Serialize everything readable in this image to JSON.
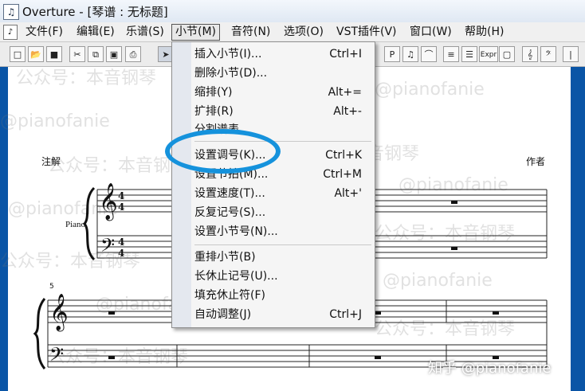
{
  "window": {
    "title": "Overture - [琴谱 : 无标题]"
  },
  "menubar": {
    "items": [
      "文件(F)",
      "编辑(E)",
      "乐谱(S)",
      "小节(M)",
      "音符(N)",
      "选项(O)",
      "VST插件(V)",
      "窗口(W)",
      "帮助(H)"
    ],
    "active": "小节(M)"
  },
  "toolbar": {
    "buttons": [
      "new",
      "open",
      "save",
      "cut",
      "copy",
      "paste",
      "print",
      "select-arrow",
      "p",
      "note",
      "slur",
      "beam",
      "staff",
      "expr",
      "box",
      "treble",
      "bass",
      "bar"
    ],
    "labels": {
      "p": "P",
      "expr": "Expr"
    }
  },
  "score": {
    "annotation_label": "注解",
    "composer_label": "作者",
    "instrument": "Piano",
    "measure_number": "5",
    "time_signature": "4/4"
  },
  "dropdown": {
    "items": [
      {
        "label": "插入小节(I)...",
        "shortcut": "Ctrl+I"
      },
      {
        "label": "删除小节(D)...",
        "shortcut": ""
      },
      {
        "label": "缩排(Y)",
        "shortcut": "Alt+="
      },
      {
        "label": "扩排(R)",
        "shortcut": "Alt+-"
      },
      {
        "label": "分割谱表",
        "shortcut": ""
      },
      {
        "label": "设置调号(K)...",
        "shortcut": "Ctrl+K"
      },
      {
        "label": "设置节拍(M)...",
        "shortcut": "Ctrl+M"
      },
      {
        "label": "设置速度(T)...",
        "shortcut": "Alt+'"
      },
      {
        "label": "反复记号(S)...",
        "shortcut": ""
      },
      {
        "label": "设置小节号(N)...",
        "shortcut": ""
      },
      {
        "label": "重排小节(B)",
        "shortcut": ""
      },
      {
        "label": "长休止记号(U)...",
        "shortcut": ""
      },
      {
        "label": "填充休止符(F)",
        "shortcut": ""
      },
      {
        "label": "自动调整(J)",
        "shortcut": "Ctrl+J"
      }
    ],
    "highlighted": "设置调号(K)..."
  },
  "watermark": {
    "lines": [
      "公众号：本音钢琴",
      "@pianofanie",
      "知乎 @pianofanie"
    ]
  },
  "colors": {
    "desktop_blue": "#0a55a6",
    "highlight_ring": "#1592dc"
  }
}
